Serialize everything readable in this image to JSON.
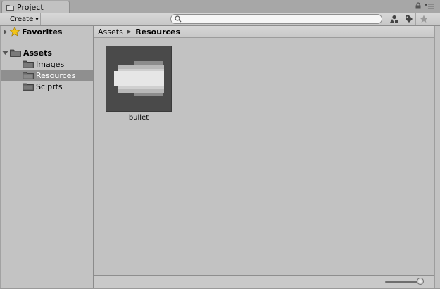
{
  "tab": {
    "title": "Project"
  },
  "toolbar": {
    "create_label": "Create",
    "search": {
      "value": "",
      "placeholder": ""
    }
  },
  "tree": {
    "favorites": "Favorites",
    "assets": "Assets",
    "folders": [
      {
        "label": "Images"
      },
      {
        "label": "Resources"
      },
      {
        "label": "Sciprts"
      }
    ],
    "selected": "Resources"
  },
  "breadcrumb": {
    "root": "Assets",
    "current": "Resources"
  },
  "items": [
    {
      "name": "bullet"
    }
  ],
  "zoom": {
    "level": 0.92
  },
  "colors": {
    "selection": "#8f8f8f",
    "tile_bg": "#4a4a4a",
    "star": "#f2c316"
  },
  "icons": [
    "project-tab-icon",
    "lock-icon",
    "menu-icon",
    "search-icon",
    "filter-by-type-icon",
    "filter-by-label-icon",
    "star-icon",
    "folder-icon"
  ]
}
